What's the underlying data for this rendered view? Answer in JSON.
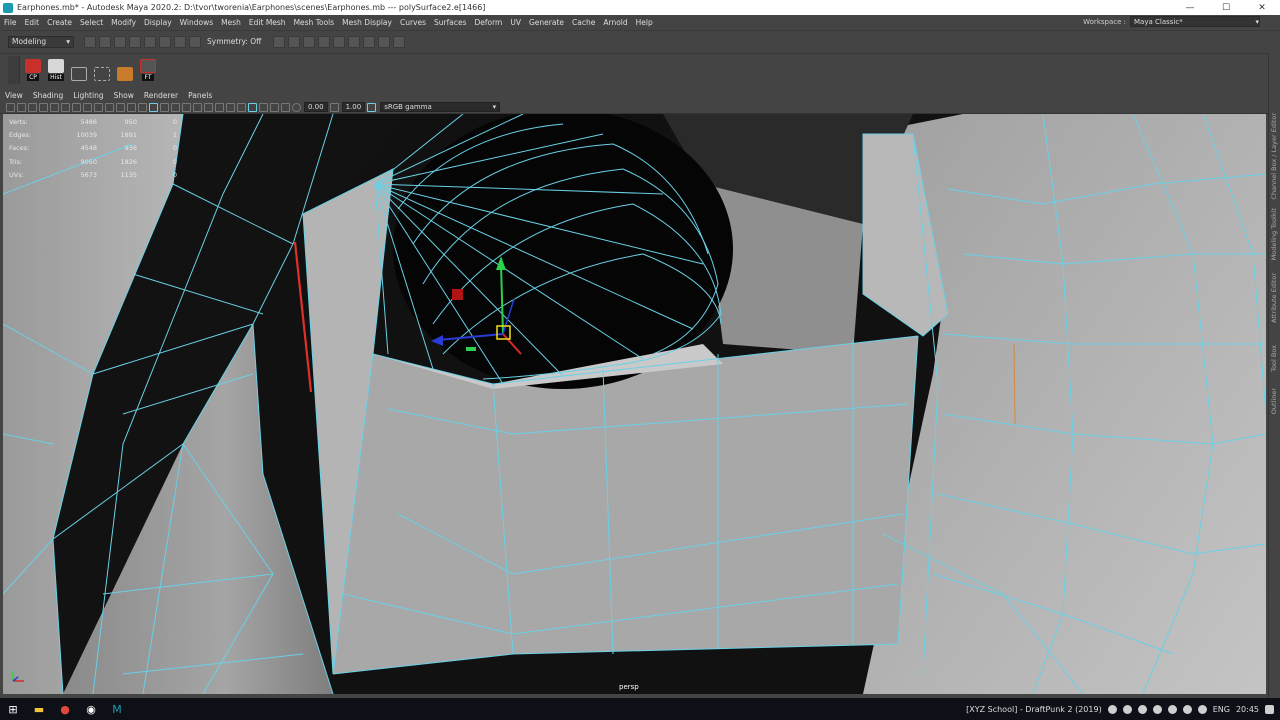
{
  "window": {
    "title": "Earphones.mb* - Autodesk Maya 2020.2: D:\\tvor\\tworenia\\Earphones\\scenes\\Earphones.mb   ---   polySurface2.e[1466]",
    "minimize": "—",
    "maximize": "☐",
    "close": "✕"
  },
  "menu": [
    "File",
    "Edit",
    "Create",
    "Select",
    "Modify",
    "Display",
    "Windows",
    "Mesh",
    "Edit Mesh",
    "Mesh Tools",
    "Mesh Display",
    "Curves",
    "Surfaces",
    "Deform",
    "UV",
    "Generate",
    "Cache",
    "Arnold",
    "Help"
  ],
  "workspace": {
    "label": "Workspace :",
    "value": "Maya Classic*"
  },
  "statusline": {
    "mode": "Modeling",
    "symmetry": "Symmetry: Off"
  },
  "shelf": [
    {
      "name": "CP",
      "color": "#c9302c"
    },
    {
      "name": "Hist",
      "color": "#d8d8d8"
    },
    {
      "name": "",
      "color": "#888"
    },
    {
      "name": "",
      "color": "#888"
    },
    {
      "name": "",
      "color": "#c97b2c"
    },
    {
      "name": "FT",
      "color": "#c9302c"
    }
  ],
  "panel_menu": [
    "View",
    "Shading",
    "Lighting",
    "Show",
    "Renderer",
    "Panels"
  ],
  "viewport_toolbar": {
    "field1": "0.00",
    "field2": "1.00",
    "colorspace": "sRGB gamma"
  },
  "hud": [
    {
      "label": "Verts:",
      "a": "5486",
      "b": "950",
      "c": "0"
    },
    {
      "label": "Edges:",
      "a": "10039",
      "b": "1891",
      "c": "1"
    },
    {
      "label": "Faces:",
      "a": "4548",
      "b": "936",
      "c": "0"
    },
    {
      "label": "Tris:",
      "a": "9050",
      "b": "1826",
      "c": "0"
    },
    {
      "label": "UVs:",
      "a": "5673",
      "b": "1135",
      "c": "0"
    }
  ],
  "camera": "persp",
  "right_tabs": [
    "Channel Box / Layer Editor",
    "Modeling Toolkit",
    "Attribute Editor",
    "Tool Box",
    "Outliner"
  ],
  "taskbar": {
    "active_window": "[XYZ School] - DraftPunk 2 (2019)",
    "lang": "ENG",
    "time": "20:45"
  },
  "colors": {
    "wire": "#6ad0e6",
    "mesh": "#a9a9a9",
    "selected_edge": "#e0302c"
  }
}
